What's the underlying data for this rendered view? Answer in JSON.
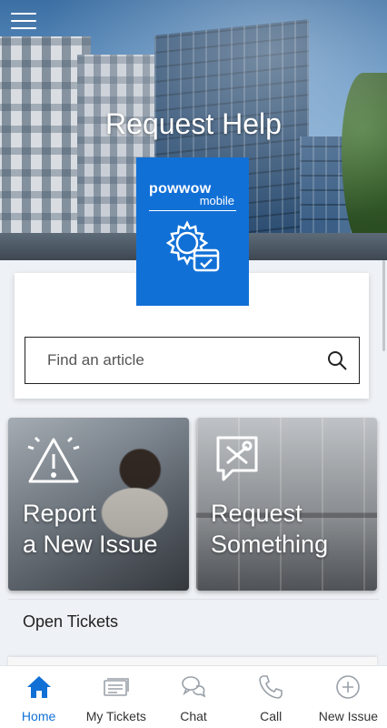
{
  "hero": {
    "title": "Request Help"
  },
  "logo": {
    "brand": "powwow",
    "sub": "mobile"
  },
  "search": {
    "placeholder": "Find an article",
    "value": ""
  },
  "tiles": [
    {
      "line1": "Report",
      "line2": "a New Issue",
      "icon": "warning-icon"
    },
    {
      "line1": "Request",
      "line2": "Something",
      "icon": "tools-icon"
    }
  ],
  "open_tickets": {
    "title": "Open Tickets"
  },
  "tabs": [
    {
      "label": "Home",
      "icon": "home-icon",
      "active": true
    },
    {
      "label": "My Tickets",
      "icon": "tickets-icon",
      "active": false
    },
    {
      "label": "Chat",
      "icon": "chat-icon",
      "active": false
    },
    {
      "label": "Call",
      "icon": "phone-icon",
      "active": false
    },
    {
      "label": "New Issue",
      "icon": "plus-circle-icon",
      "active": false
    }
  ],
  "colors": {
    "accent": "#1170d6",
    "tab_inactive": "#9aa1a9"
  }
}
